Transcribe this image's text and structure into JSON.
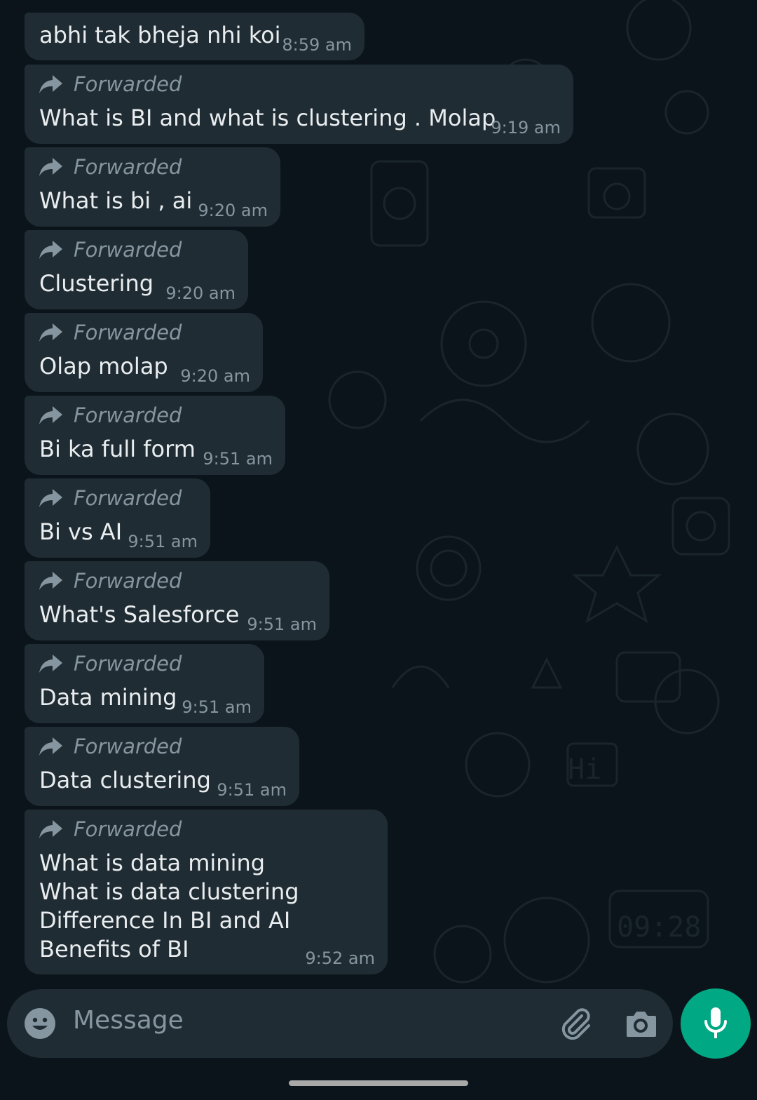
{
  "colors": {
    "background": "#0b141a",
    "bubble_incoming": "#202c33",
    "text_primary": "#e9edef",
    "text_secondary": "#8696a0",
    "accent": "#00a884"
  },
  "forwarded_icon": "forward-arrow-icon",
  "messages": [
    {
      "forwarded": false,
      "text": "abhi tak bheja nhi koi",
      "time": "8:59 am"
    },
    {
      "forwarded": true,
      "label": "Forwarded",
      "text": "What is BI and what is clustering . Molap",
      "time": "9:19 am"
    },
    {
      "forwarded": true,
      "label": "Forwarded",
      "text": "What is bi , ai",
      "time": "9:20 am"
    },
    {
      "forwarded": true,
      "label": "Forwarded",
      "text": "Clustering",
      "time": "9:20 am"
    },
    {
      "forwarded": true,
      "label": "Forwarded",
      "text": "Olap molap",
      "time": "9:20 am"
    },
    {
      "forwarded": true,
      "label": "Forwarded",
      "text": "Bi ka full form",
      "time": "9:51 am"
    },
    {
      "forwarded": true,
      "label": "Forwarded",
      "text": "Bi vs AI",
      "time": "9:51 am"
    },
    {
      "forwarded": true,
      "label": "Forwarded",
      "text": "What's Salesforce",
      "time": "9:51 am"
    },
    {
      "forwarded": true,
      "label": "Forwarded",
      "text": "Data mining",
      "time": "9:51 am"
    },
    {
      "forwarded": true,
      "label": "Forwarded",
      "text": "Data clustering",
      "time": "9:51 am"
    },
    {
      "forwarded": true,
      "label": "Forwarded",
      "text": "What is data mining\nWhat is data clustering\nDifference In BI and AI\nBenefits of BI",
      "time": "9:52 am"
    }
  ],
  "composer": {
    "placeholder": "Message",
    "emoji_icon": "emoji-icon",
    "attach_icon": "paperclip-icon",
    "camera_icon": "camera-icon",
    "mic_icon": "microphone-icon"
  }
}
